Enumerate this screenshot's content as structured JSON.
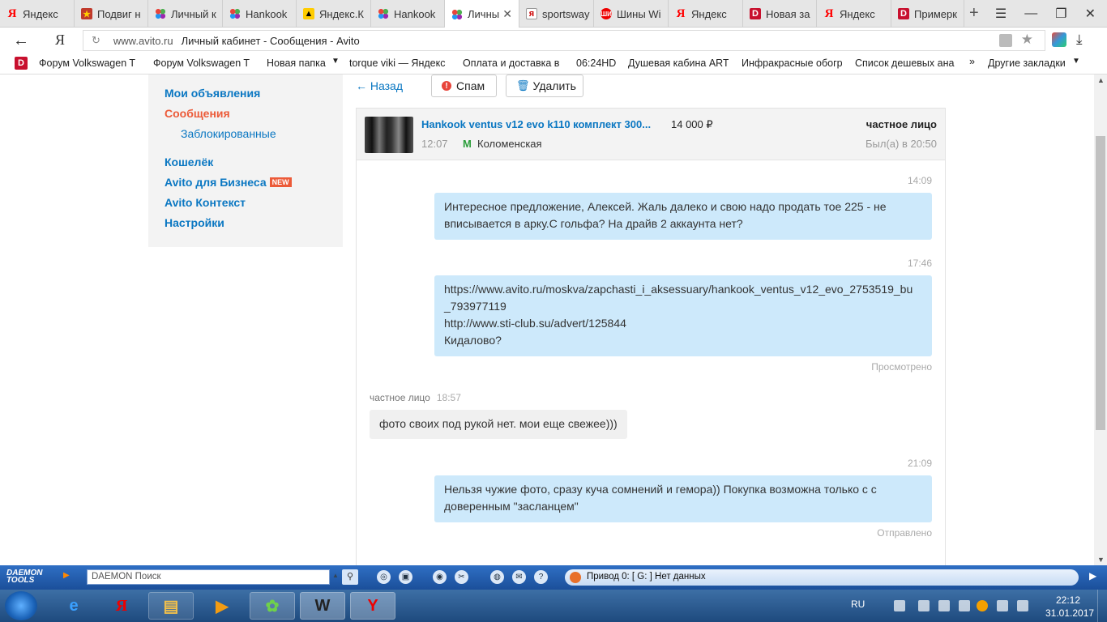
{
  "tabs": [
    {
      "label": "Яндекс",
      "icon": "yandex-icon",
      "active": false
    },
    {
      "label": "Подвиг н",
      "icon": "podvig-icon",
      "active": false
    },
    {
      "label": "Личный к",
      "icon": "avito-icon",
      "active": false
    },
    {
      "label": "Hankook",
      "icon": "avito-icon",
      "active": false
    },
    {
      "label": "Яндекс.К",
      "icon": "yandex-maps-icon",
      "active": false
    },
    {
      "label": "Hankook",
      "icon": "avito-icon",
      "active": false
    },
    {
      "label": "Личны",
      "icon": "avito-icon",
      "active": true
    },
    {
      "label": "sportsway",
      "icon": "sportsway-icon",
      "active": false
    },
    {
      "label": "Шины Wi",
      "icon": "tire-icon",
      "active": false
    },
    {
      "label": "Яндекс",
      "icon": "yandex-icon",
      "active": false
    },
    {
      "label": "Новая за",
      "icon": "drive2-icon",
      "active": false
    },
    {
      "label": "Яндекс",
      "icon": "yandex-icon",
      "active": false
    },
    {
      "label": "Примерк",
      "icon": "drive2-icon",
      "active": false
    }
  ],
  "address": {
    "logo": "Я",
    "domain": "www.avito.ru",
    "title": "Личный кабинет - Сообщения - Avito"
  },
  "bookmarks": [
    "Форум Volkswagen T",
    "Форум Volkswagen T",
    "Новая папка",
    "torque viki — Яндекс",
    "Оплата и доставка в",
    "06:24HD",
    "Душевая кабина ART",
    "Инфракрасные обогр",
    "Список дешевых ана",
    "Другие закладки"
  ],
  "sidebar": {
    "my_ads": "Мои объявления",
    "messages": "Сообщения",
    "blocked": "Заблокированные",
    "wallet": "Кошелёк",
    "business": "Avito для Бизнеса",
    "business_badge": "NEW",
    "context": "Avito Контекст",
    "settings": "Настройки"
  },
  "toolbar": {
    "back": "← Назад",
    "spam": "Спам",
    "delete": "Удалить"
  },
  "item": {
    "title": "Hankook ventus v12 evo k110 комплект 300...",
    "price": "14 000 ₽",
    "time": "12:07",
    "metro": "Коломенская",
    "seller": "частное лицо",
    "last_seen": "Был(а) в 20:50"
  },
  "messages": {
    "m1": {
      "time": "14:09",
      "text": "Интересное предложение, Алексей. Жаль далеко и свою надо продать тое 225 - не вписывается в арку.С гольфа? На драйв 2 аккаунта нет?"
    },
    "m2": {
      "time": "17:46",
      "line1": "https://www.avito.ru/moskva/zapchasti_i_aksessuary/hankook_ventus_v12_evo_2753519_bu",
      "line2": "_793977119",
      "line3": "http://www.sti-club.su/advert/125844",
      "line4": "Кидалово?",
      "status": "Просмотрено"
    },
    "m3": {
      "sender": "частное лицо",
      "time": "18:57",
      "text": "фото своих под рукой нет. мои еще свежее)))"
    },
    "m4": {
      "time": "21:09",
      "text": "Нельзя чужие фото, сразу куча сомнений и гемора)) Покупка  возможна только с с доверенным \"засланцем\"",
      "status": "Отправлено"
    }
  },
  "daemon": {
    "logo": "DAEMON TOOLS",
    "search_placeholder": "DAEMON Поиск",
    "drive": "Привод 0: [ G: ] Нет данных"
  },
  "taskbar": {
    "lang": "RU",
    "time": "22:12",
    "date": "31.01.2017"
  }
}
